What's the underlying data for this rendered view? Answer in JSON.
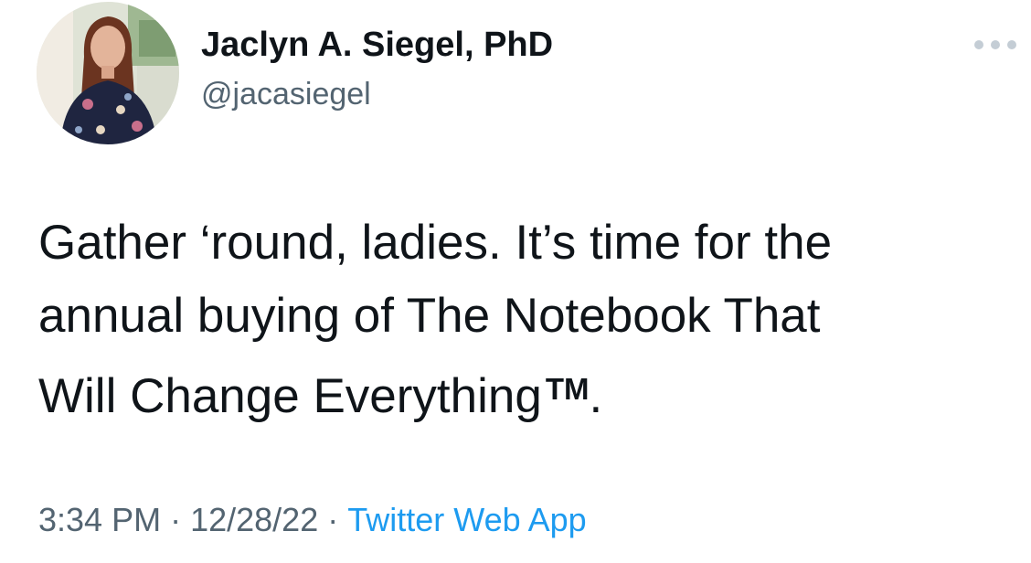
{
  "author": {
    "name": "Jaclyn A. Siegel, PhD",
    "handle": "@jacasiegel"
  },
  "tweet": {
    "line1": "Gather ‘round, ladies. It’s time for the",
    "line2": "annual buying of The Notebook That",
    "line3": "Will Change Everything",
    "trademark": "TM",
    "ending": "."
  },
  "meta": {
    "time": "3:34 PM",
    "separator": "·",
    "date": "12/28/22",
    "source": "Twitter Web App"
  },
  "colors": {
    "text": "#0f1419",
    "secondary": "#536471",
    "link": "#1d9bf0"
  },
  "icons": {
    "more": "more-horizontal-icon"
  }
}
